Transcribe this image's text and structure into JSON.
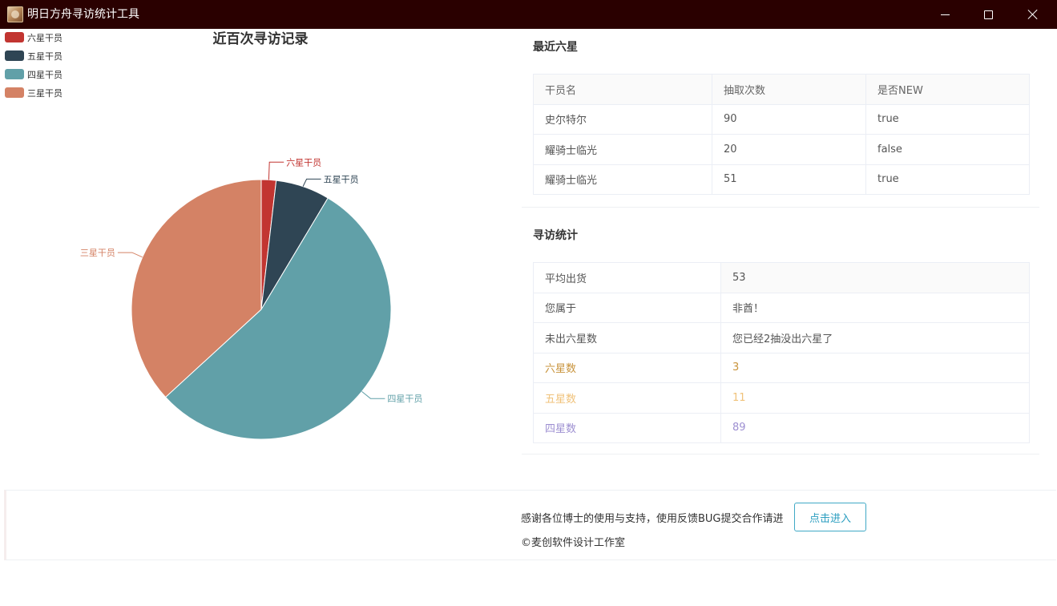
{
  "window": {
    "title": "明日方舟寻访统计工具"
  },
  "colors": {
    "titlebar": "#2a0000",
    "six_star": "#c23531",
    "five_star": "#2f4554",
    "four_star": "#61a0a8",
    "three_star": "#d48265",
    "stat_six": "#c8933b",
    "stat_five": "#f0c27a",
    "stat_four": "#9d8fd1"
  },
  "chart_data": {
    "type": "pie",
    "title": "近百次寻访记录",
    "legend_position": "top-left",
    "slices": [
      {
        "name": "六星干员",
        "value": 3,
        "color": "#c23531"
      },
      {
        "name": "五星干员",
        "value": 11,
        "color": "#2f4554"
      },
      {
        "name": "四星干员",
        "value": 89,
        "color": "#61a0a8"
      },
      {
        "name": "三星干员",
        "value": 60,
        "color": "#d48265"
      }
    ]
  },
  "recent_six": {
    "title": "最近六星",
    "headers": [
      "干员名",
      "抽取次数",
      "是否NEW"
    ],
    "rows": [
      [
        "史尔特尔",
        "90",
        "true"
      ],
      [
        "耀骑士临光",
        "20",
        "false"
      ],
      [
        "耀骑士临光",
        "51",
        "true"
      ]
    ]
  },
  "stats": {
    "title": "寻访统计",
    "rows": [
      [
        "平均出货",
        "53"
      ],
      [
        "您属于",
        "非酋！"
      ],
      [
        "未出六星数",
        "您已经2抽没出六星了"
      ],
      [
        "六星数",
        "3"
      ],
      [
        "五星数",
        "11"
      ],
      [
        "四星数",
        "89"
      ]
    ]
  },
  "footer": {
    "thanks_text": "感谢各位博士的使用与支持，使用反馈BUG提交合作请进",
    "enter_button": "点击进入",
    "copyright": "©麦创软件设计工作室"
  }
}
